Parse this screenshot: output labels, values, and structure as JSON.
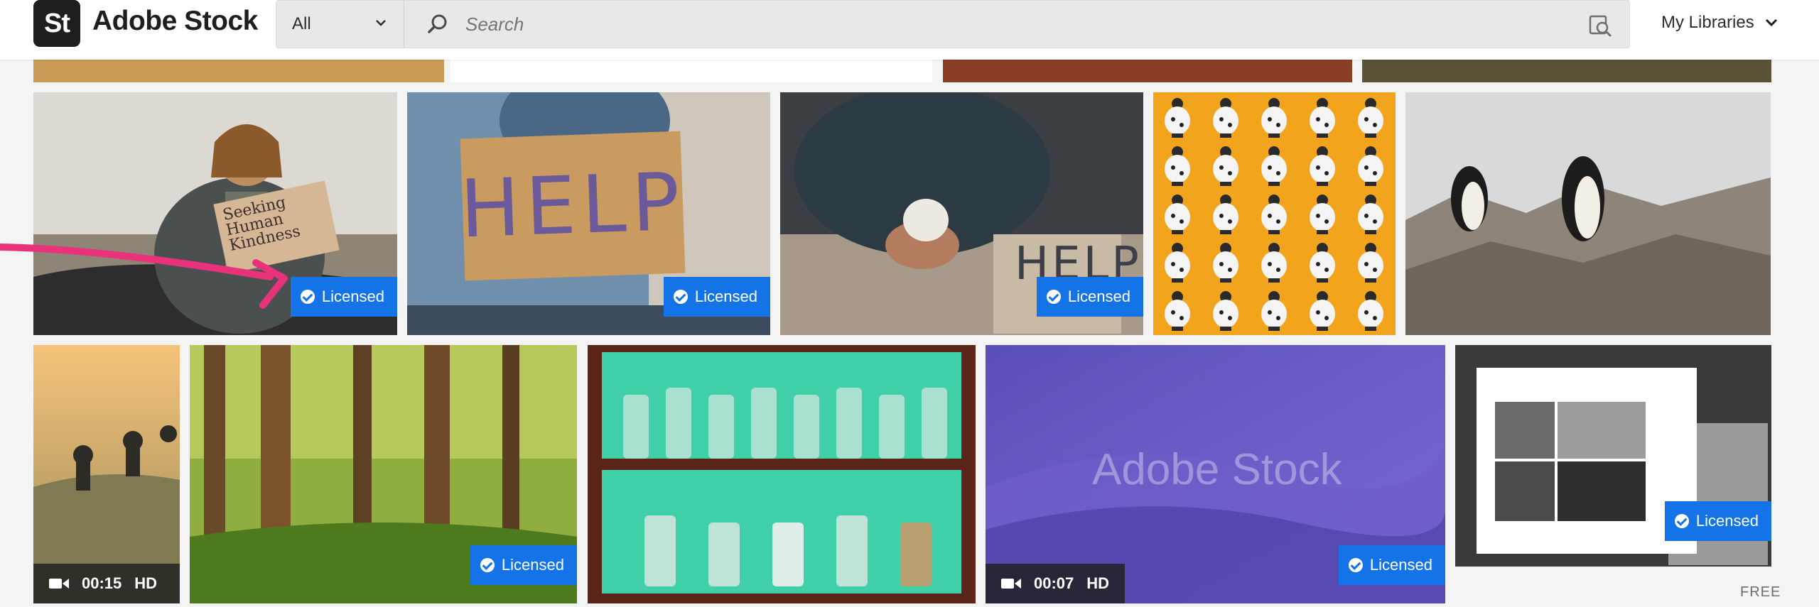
{
  "header": {
    "logo_mark": "St",
    "brand": "Adobe Stock",
    "search": {
      "scope": "All",
      "placeholder": "Search"
    },
    "my_libraries": "My Libraries"
  },
  "badges": {
    "licensed": "Licensed"
  },
  "videos": [
    {
      "duration": "00:15",
      "quality": "HD"
    },
    {
      "duration": "00:07",
      "quality": "HD"
    }
  ],
  "tiles": {
    "man_sign": {
      "sign": [
        "Seeking",
        "Human",
        "Kindness"
      ]
    },
    "help_sign": {
      "sign": "HELP"
    },
    "cup_sign": {
      "sign": "HELP"
    },
    "watermark": "Adobe Stock"
  },
  "free_label": "FREE",
  "colors": {
    "accent": "#1473e6",
    "header_bg": "#ffffff",
    "page_bg": "#f4f4f4",
    "mustard": "#f2a51c"
  },
  "icons": [
    "search-icon",
    "visual-search-icon",
    "chevron-down-icon",
    "video-camera-icon",
    "check-circle-icon"
  ]
}
